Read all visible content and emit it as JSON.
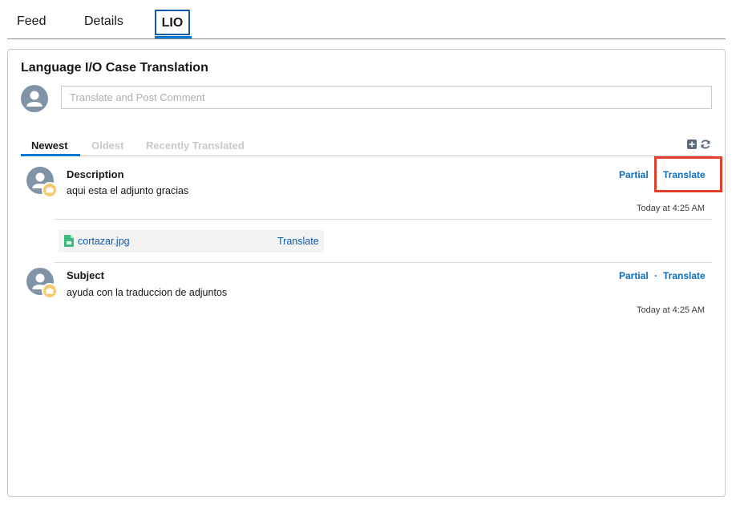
{
  "top_tabs": {
    "feed": "Feed",
    "details": "Details",
    "lio": "LIO"
  },
  "card": {
    "title": "Language I/O Case Translation",
    "comment_placeholder": "Translate and Post Comment"
  },
  "sort_tabs": {
    "newest": "Newest",
    "oldest": "Oldest",
    "recent": "Recently Translated"
  },
  "tools": {
    "add_icon": "add-icon",
    "refresh_icon": "refresh-icon"
  },
  "entries": [
    {
      "title": "Description",
      "text": "aqui esta el adjunto gracias",
      "partial_label": "Partial",
      "translate_label": "Translate",
      "timestamp": "Today at 4:25 AM",
      "attachment": {
        "file_name": "cortazar.jpg",
        "translate_label": "Translate"
      }
    },
    {
      "title": "Subject",
      "text": "ayuda con la traduccion de adjuntos",
      "partial_label": "Partial",
      "separator": "·",
      "translate_label": "Translate",
      "timestamp": "Today at 4:25 AM"
    }
  ],
  "colors": {
    "accent": "#0176d3",
    "link": "#0b6ebc",
    "avatar": "#8193a6",
    "badge": "#f4c96b",
    "highlight": "#e0402a"
  }
}
